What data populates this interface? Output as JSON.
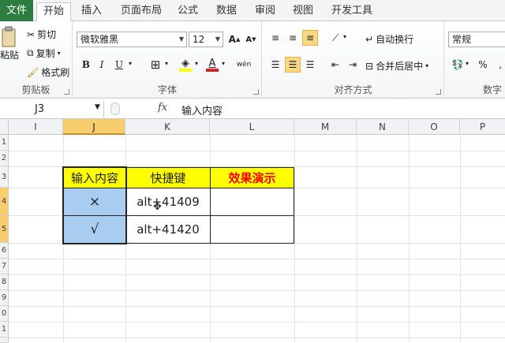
{
  "tabs": [
    "文件",
    "开始",
    "插入",
    "页面布局",
    "公式",
    "数据",
    "审阅",
    "视图",
    "开发工具"
  ],
  "clipboard": {
    "paste_label": "粘贴",
    "cut_label": "剪切",
    "copy_label": "复制",
    "format_painter_label": "格式刷",
    "group_label": "剪贴板"
  },
  "font": {
    "font_name": "微软雅黑",
    "font_size": "12",
    "group_label": "字体",
    "bold": "B",
    "italic": "I",
    "underline": "U",
    "phonetic": "wén"
  },
  "alignment": {
    "wrap_text_label": "自动换行",
    "merge_center_label": "合并后居中",
    "group_label": "对齐方式"
  },
  "number": {
    "format": "常规",
    "group_label": "数字",
    "percent": "%"
  },
  "formula_bar": {
    "name_box": "J3",
    "fx": "fx",
    "value": "输入内容"
  },
  "columns": [
    "I",
    "J",
    "K",
    "L",
    "M",
    "N",
    "O",
    "P"
  ],
  "rows": [
    "1",
    "2",
    "3",
    "4",
    "5",
    "6",
    "7",
    "8",
    "9",
    "0",
    "1"
  ],
  "table": {
    "header": [
      "输入内容",
      "快捷键",
      "效果演示"
    ],
    "rows": [
      [
        "×",
        "alt+41409",
        ""
      ],
      [
        "√",
        "alt+41420",
        ""
      ]
    ]
  },
  "colors": {
    "file_tab": "#2b7e3f",
    "header_fill": "#ffff00",
    "selected_fill": "#a9cdf0",
    "accent_text": "#ff0000"
  }
}
